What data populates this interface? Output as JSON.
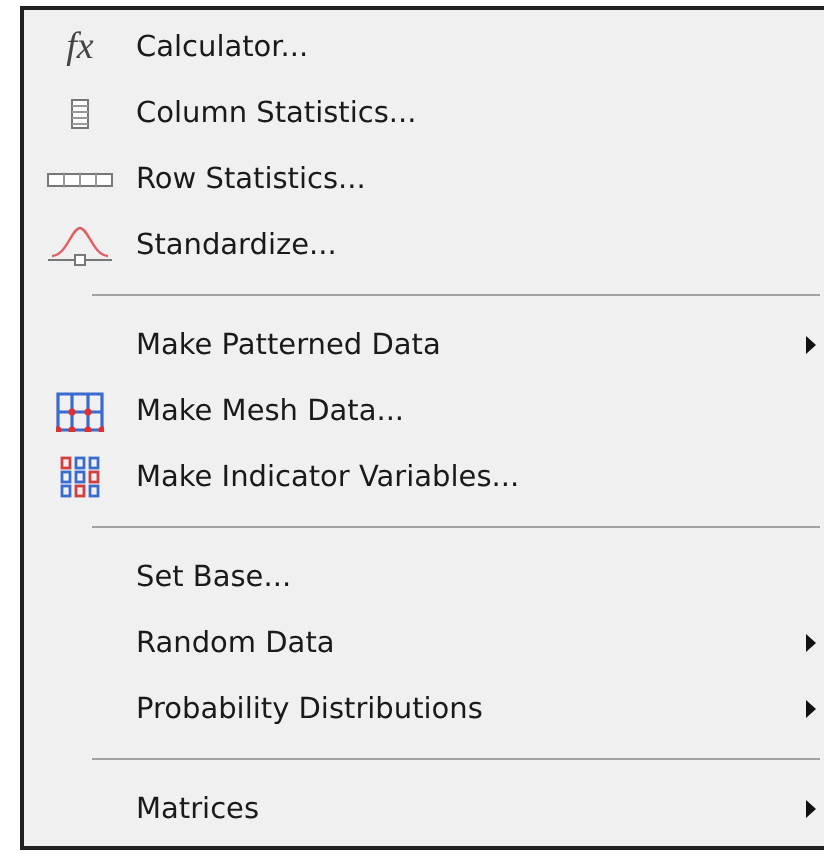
{
  "menu": {
    "items": [
      {
        "kind": "formula",
        "symbol": "fx",
        "label": "Calculator...",
        "submenu": false
      },
      {
        "kind": "column",
        "label": "Column Statistics...",
        "submenu": false
      },
      {
        "kind": "row",
        "label": "Row Statistics...",
        "submenu": false
      },
      {
        "kind": "curve",
        "label": "Standardize...",
        "submenu": false
      },
      {
        "kind": "separator"
      },
      {
        "kind": "plain",
        "label": "Make Patterned Data",
        "submenu": true
      },
      {
        "kind": "mesh",
        "label": "Make Mesh Data...",
        "submenu": false
      },
      {
        "kind": "indicator",
        "label": "Make Indicator Variables...",
        "submenu": false
      },
      {
        "kind": "separator"
      },
      {
        "kind": "plain",
        "label": "Set Base...",
        "submenu": false
      },
      {
        "kind": "plain",
        "label": "Random Data",
        "submenu": true
      },
      {
        "kind": "plain",
        "label": "Probability Distributions",
        "submenu": true
      },
      {
        "kind": "separator"
      },
      {
        "kind": "plain",
        "label": "Matrices",
        "submenu": true
      }
    ]
  }
}
